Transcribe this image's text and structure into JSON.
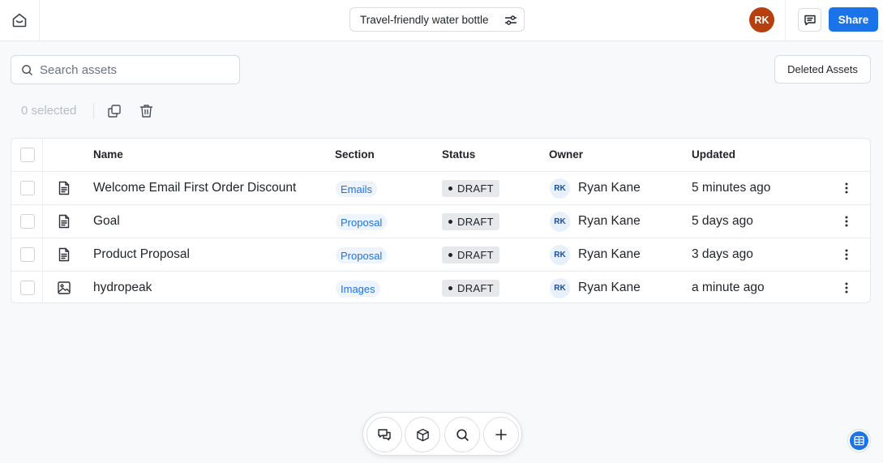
{
  "header": {
    "project_title": "Travel-friendly water bottle",
    "user_initials": "RK",
    "share_label": "Share",
    "avatar_color": "#b5400d",
    "accent_color": "#1a73e8"
  },
  "search": {
    "placeholder": "Search assets"
  },
  "deleted_assets_label": "Deleted Assets",
  "selection": {
    "count_label": "0 selected"
  },
  "table": {
    "columns": [
      "Name",
      "Section",
      "Status",
      "Owner",
      "Updated"
    ],
    "rows": [
      {
        "type_icon": "document-icon",
        "name": "Welcome Email First Order Discount",
        "section": "Emails",
        "status": "DRAFT",
        "owner_initials": "RK",
        "owner": "Ryan Kane",
        "updated": "5 minutes ago"
      },
      {
        "type_icon": "document-icon",
        "name": "Goal",
        "section": "Proposal",
        "status": "DRAFT",
        "owner_initials": "RK",
        "owner": "Ryan Kane",
        "updated": "5 days ago"
      },
      {
        "type_icon": "document-icon",
        "name": "Product Proposal",
        "section": "Proposal",
        "status": "DRAFT",
        "owner_initials": "RK",
        "owner": "Ryan Kane",
        "updated": "3 days ago"
      },
      {
        "type_icon": "image-icon",
        "name": "hydropeak",
        "section": "Images",
        "status": "DRAFT",
        "owner_initials": "RK",
        "owner": "Ryan Kane",
        "updated": "a minute ago"
      }
    ]
  },
  "toolbar": {
    "icons": [
      "chat-icon",
      "cube-icon",
      "search-icon",
      "plus-icon"
    ]
  },
  "fab": {
    "icon": "grid-icon"
  }
}
